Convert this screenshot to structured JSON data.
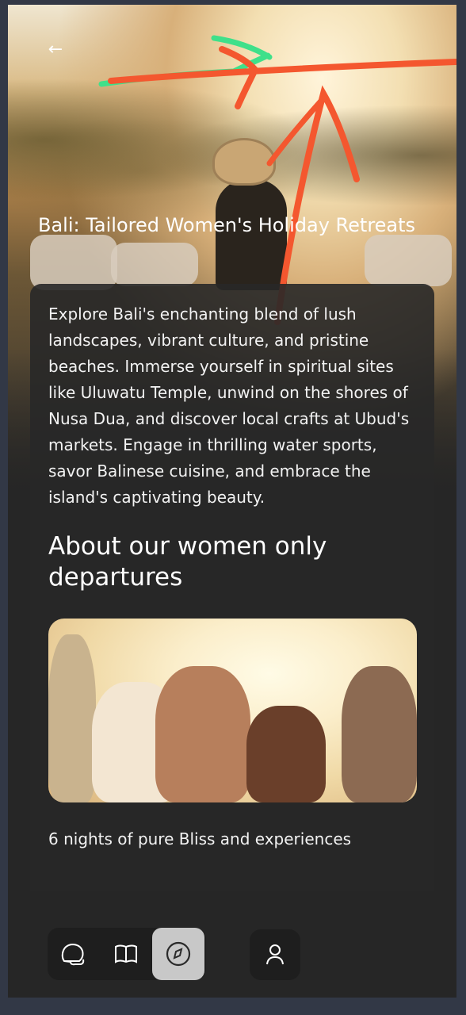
{
  "header": {
    "back_icon": "arrow-left-icon",
    "title": "Bali: Tailored Women's Holiday Retreats"
  },
  "content": {
    "description": "Explore Bali's enchanting blend of lush landscapes, vibrant culture, and pristine beaches. Immerse yourself in spiritual sites like Uluwatu Temple, unwind on the shores of Nusa Dua, and discover local crafts at Ubud's markets. Engage in thrilling water sports, savor Balinese cuisine, and embrace the island's captivating beauty.",
    "section_heading": "About our women only departures",
    "caption": "6 nights of pure Bliss and experiences"
  },
  "bottom_nav": {
    "items": [
      {
        "icon": "chat-bubbles-icon",
        "active": false
      },
      {
        "icon": "map-book-icon",
        "active": false
      },
      {
        "icon": "compass-icon",
        "active": true
      }
    ],
    "profile_icon": "user-icon"
  },
  "colors": {
    "background": "#262626",
    "frame": "#323846",
    "scribble_red": "#f4572f",
    "scribble_green": "#3fe08a",
    "active_nav": "#c8c8c8"
  }
}
